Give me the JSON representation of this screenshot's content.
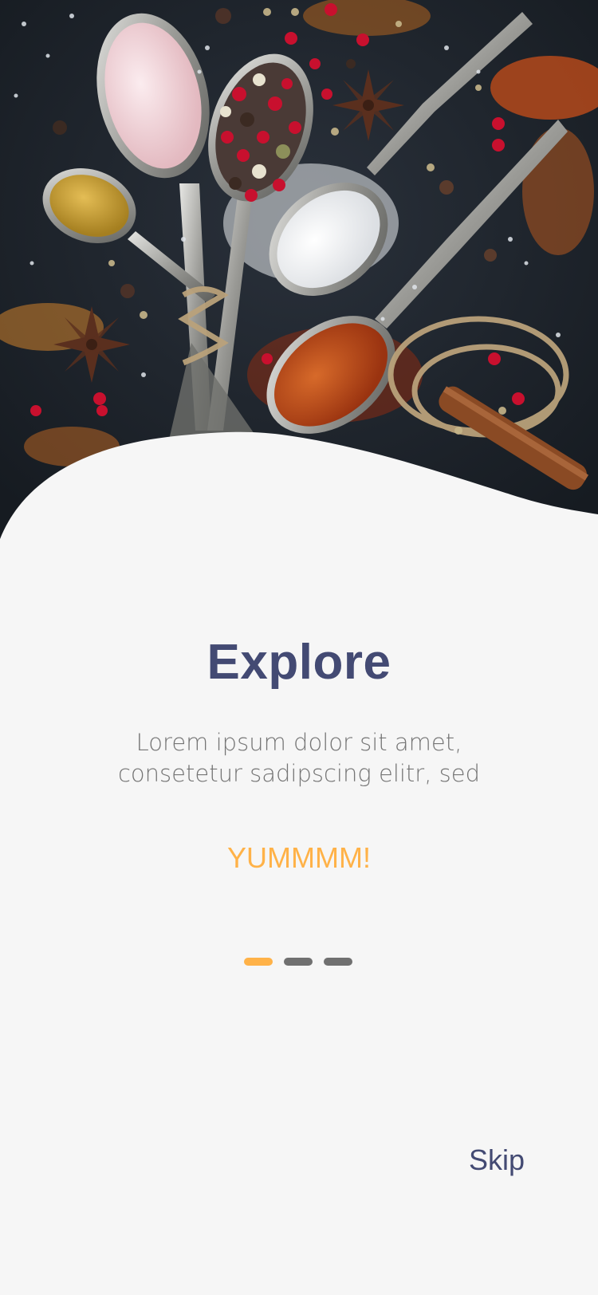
{
  "onboarding": {
    "title": "Explore",
    "subtitle_line1": "Lorem ipsum dolor sit amet,",
    "subtitle_line2": "consetetur sadipscing elitr, sed",
    "tagline": "YUMMMM!",
    "skip_label": "Skip",
    "pages_total": 3,
    "current_page": 1
  },
  "hero": {
    "image": "spices-on-spoons-photo"
  },
  "colors": {
    "title": "#434a73",
    "accent": "#ffb248",
    "dot_inactive": "#707070",
    "background": "#f6f6f6",
    "hero_dark": "#1d2229"
  }
}
